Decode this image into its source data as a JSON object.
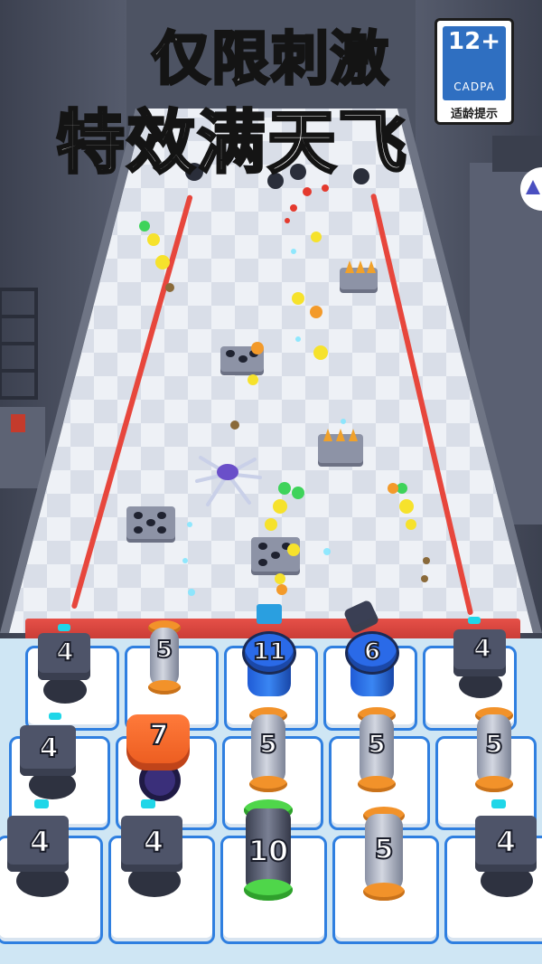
{
  "title": {
    "line1": "仅限刺激",
    "line2": "特效满天飞"
  },
  "age_rating": {
    "age": "12+",
    "org": "CADPA",
    "hint": "适龄提示"
  },
  "turrets": {
    "row1": [
      "4",
      "5",
      "11",
      "6",
      "4"
    ],
    "row2": [
      "4",
      "7",
      "5",
      "5",
      "5"
    ],
    "row3": [
      "4",
      "4",
      "10",
      "5",
      "4"
    ]
  },
  "colors": {
    "grid_border": "#2f7fe0",
    "laser": "#e7463c",
    "turret_orange_cap": "#f2922a",
    "turret_blue": "#2a6ae8",
    "turret_green_cap": "#4fd64a"
  }
}
